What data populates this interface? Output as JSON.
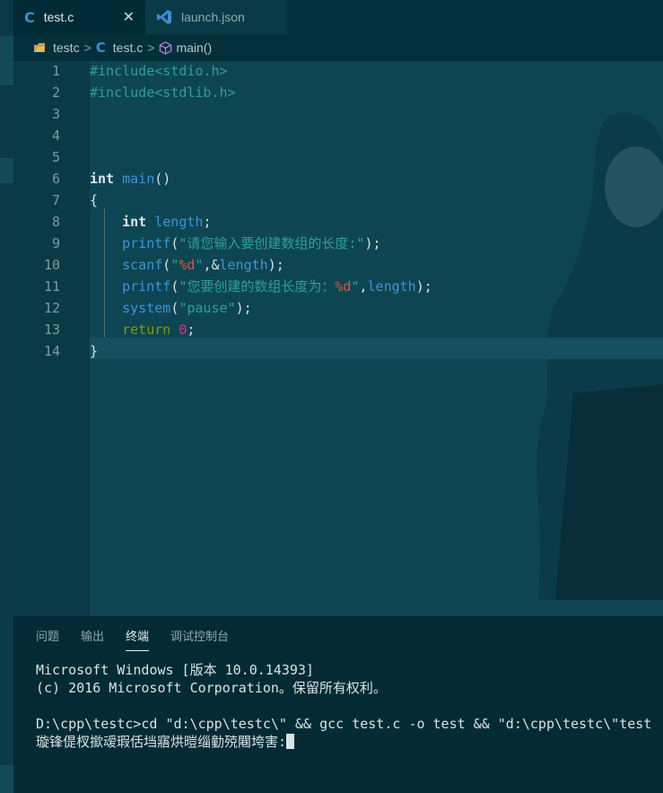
{
  "tabs": [
    {
      "icon": "C",
      "label": "test.c",
      "close": "✕"
    },
    {
      "label": "launch.json"
    }
  ],
  "breadcrumb": {
    "folder": "testc",
    "file_icon": "C",
    "file": "test.c",
    "symbol": "main()"
  },
  "editor": {
    "lines": [
      {
        "n": "1",
        "tokens": [
          [
            "pre",
            "#include"
          ],
          [
            "str",
            "<stdio.h>"
          ]
        ]
      },
      {
        "n": "2",
        "tokens": [
          [
            "pre",
            "#include"
          ],
          [
            "str",
            "<stdlib.h>"
          ]
        ]
      },
      {
        "n": "3",
        "tokens": []
      },
      {
        "n": "4",
        "tokens": []
      },
      {
        "n": "5",
        "tokens": []
      },
      {
        "n": "6",
        "tokens": [
          [
            "kw",
            "int"
          ],
          [
            "punc",
            " "
          ],
          [
            "fn",
            "main"
          ],
          [
            "punc",
            "()"
          ]
        ]
      },
      {
        "n": "7",
        "tokens": [
          [
            "punc",
            "{"
          ]
        ]
      },
      {
        "n": "8",
        "tokens": [
          [
            "punc",
            "    "
          ],
          [
            "kw",
            "int"
          ],
          [
            "punc",
            " "
          ],
          [
            "id",
            "length"
          ],
          [
            "punc",
            ";"
          ]
        ]
      },
      {
        "n": "9",
        "tokens": [
          [
            "punc",
            "    "
          ],
          [
            "fn",
            "printf"
          ],
          [
            "punc",
            "("
          ],
          [
            "str",
            "\"请您输入要创建数组的长度:\""
          ],
          [
            "punc",
            ");"
          ]
        ]
      },
      {
        "n": "10",
        "tokens": [
          [
            "punc",
            "    "
          ],
          [
            "fn",
            "scanf"
          ],
          [
            "punc",
            "("
          ],
          [
            "str",
            "\""
          ],
          [
            "fmt",
            "%d"
          ],
          [
            "str",
            "\""
          ],
          [
            "punc",
            ",&"
          ],
          [
            "id",
            "length"
          ],
          [
            "punc",
            ");"
          ]
        ]
      },
      {
        "n": "11",
        "tokens": [
          [
            "punc",
            "    "
          ],
          [
            "fn",
            "printf"
          ],
          [
            "punc",
            "("
          ],
          [
            "str",
            "\"您要创建的数组长度为："
          ],
          [
            "fmt",
            "%d"
          ],
          [
            "str",
            "\""
          ],
          [
            "punc",
            ","
          ],
          [
            "id",
            "length"
          ],
          [
            "punc",
            ");"
          ]
        ]
      },
      {
        "n": "12",
        "tokens": [
          [
            "punc",
            "    "
          ],
          [
            "fn",
            "system"
          ],
          [
            "punc",
            "("
          ],
          [
            "str",
            "\"pause\""
          ],
          [
            "punc",
            ");"
          ]
        ]
      },
      {
        "n": "13",
        "tokens": [
          [
            "punc",
            "    "
          ],
          [
            "ret",
            "return"
          ],
          [
            "punc",
            " "
          ],
          [
            "num",
            "0"
          ],
          [
            "punc",
            ";"
          ]
        ]
      },
      {
        "n": "14",
        "tokens": [
          [
            "punc",
            "}"
          ]
        ]
      }
    ]
  },
  "panel": {
    "tabs": [
      "问题",
      "输出",
      "终端",
      "调试控制台"
    ],
    "active_tab": "终端",
    "terminal": {
      "line1": "Microsoft Windows [版本 10.0.14393]",
      "line2": "(c) 2016 Microsoft Corporation。保留所有权利。",
      "line3": "",
      "line4": "D:\\cpp\\testc>cd \"d:\\cpp\\testc\\\" && gcc test.c -o test && \"d:\\cpp\\testc\\\"test",
      "line5": "璇锋偍杈撳叆瑕佸垱寤烘暟缁勭殑闀垮害:"
    }
  }
}
